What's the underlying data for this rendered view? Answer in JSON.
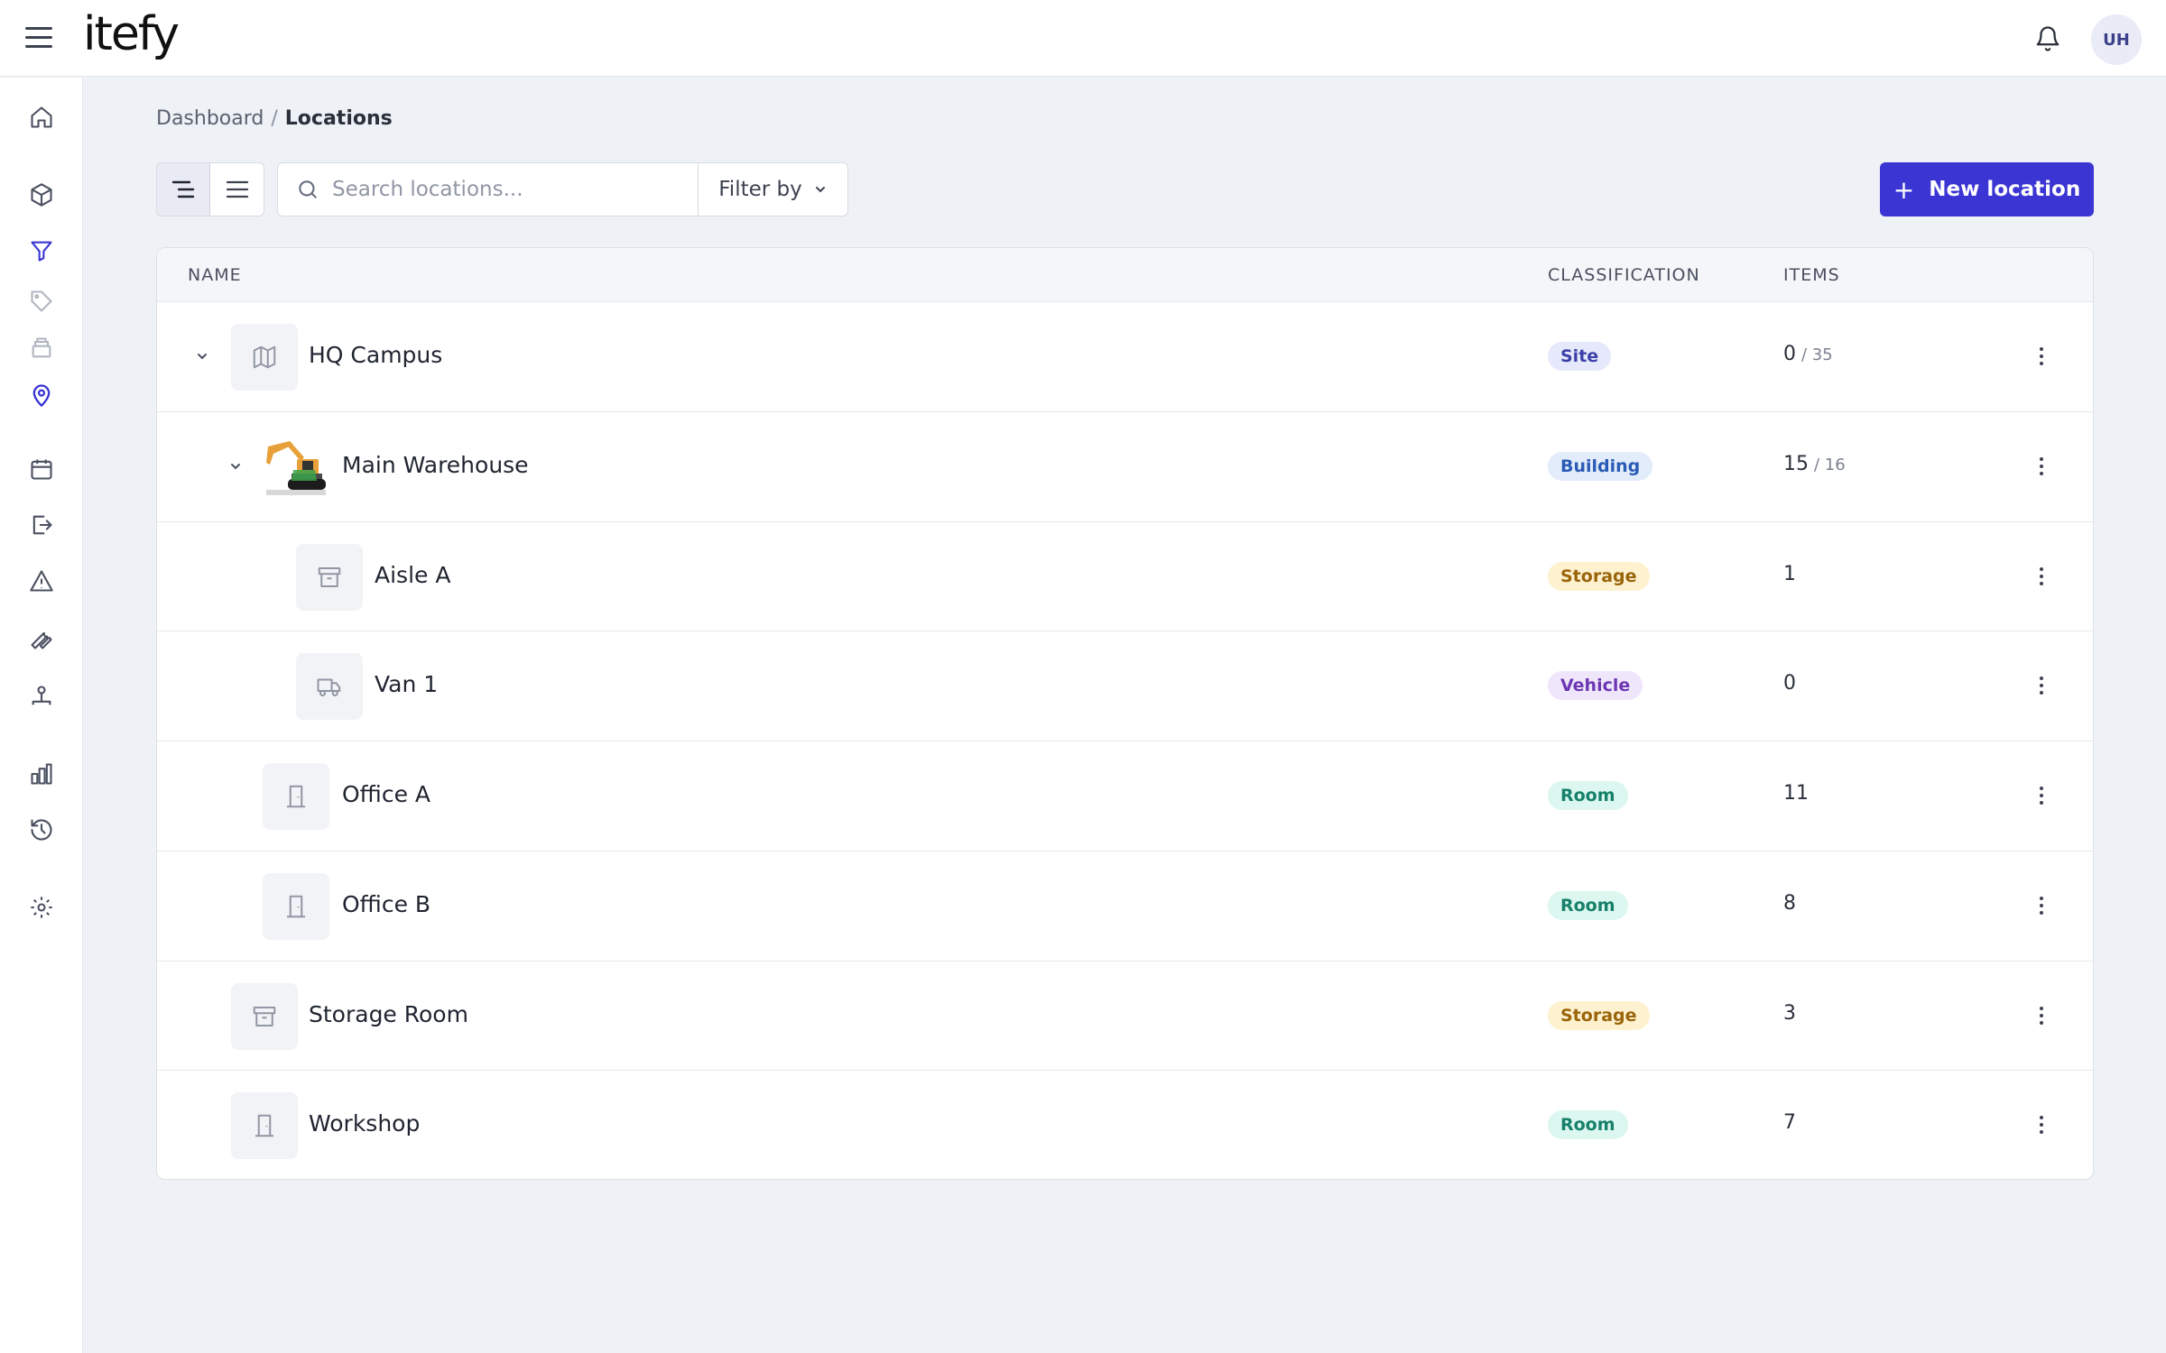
{
  "app": {
    "logo": "itefy",
    "avatar_initials": "UH"
  },
  "breadcrumb": {
    "root": "Dashboard",
    "separator": "/",
    "current": "Locations"
  },
  "toolbar": {
    "search_placeholder": "Search locations...",
    "filter_label": "Filter by",
    "new_label": "New location"
  },
  "table": {
    "headers": {
      "name": "NAME",
      "classification": "CLASSIFICATION",
      "items": "ITEMS"
    },
    "rows": [
      {
        "name": "HQ Campus",
        "classification": "Site",
        "items": "0",
        "total": "/ 35",
        "icon": "map-icon",
        "expanded": true
      },
      {
        "name": "Main Warehouse",
        "classification": "Building",
        "items": "15",
        "total": "/ 16",
        "icon": "excavator-image",
        "expanded": true
      },
      {
        "name": "Aisle A",
        "classification": "Storage",
        "items": "1",
        "total": "",
        "icon": "archive-icon"
      },
      {
        "name": "Van 1",
        "classification": "Vehicle",
        "items": "0",
        "total": "",
        "icon": "truck-icon"
      },
      {
        "name": "Office A",
        "classification": "Room",
        "items": "11",
        "total": "",
        "icon": "door-icon"
      },
      {
        "name": "Office B",
        "classification": "Room",
        "items": "8",
        "total": "",
        "icon": "door-icon"
      },
      {
        "name": "Storage Room",
        "classification": "Storage",
        "items": "3",
        "total": "",
        "icon": "archive-icon"
      },
      {
        "name": "Workshop",
        "classification": "Room",
        "items": "7",
        "total": "",
        "icon": "door-icon"
      }
    ]
  },
  "badge_colors": {
    "Site": {
      "bg": "#e6e8fb",
      "fg": "#3b3fa8"
    },
    "Building": {
      "bg": "#e2ecfb",
      "fg": "#2a5bb5"
    },
    "Storage": {
      "bg": "#fdf1cf",
      "fg": "#9a6409"
    },
    "Vehicle": {
      "bg": "#efe6fb",
      "fg": "#6d37b3"
    },
    "Room": {
      "bg": "#dbf7ef",
      "fg": "#17806a"
    }
  },
  "accent_color": "#3b35d4"
}
